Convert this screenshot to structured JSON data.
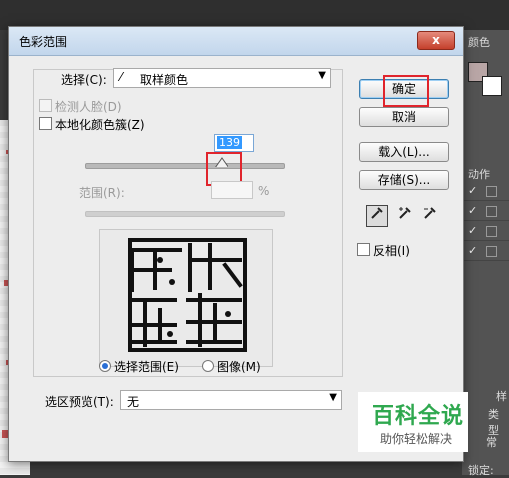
{
  "dialog": {
    "title": "色彩范围",
    "close_label": "x",
    "select_label": "选择(C):",
    "select_value": "取样颜色",
    "detect_faces_label": "检测人脸(D)",
    "localized_clusters_label": "本地化颜色簇(Z)",
    "fuzziness_value": "139",
    "range_label": "范围(R):",
    "range_unit": "%",
    "radio_selection_label": "选择范围(E)",
    "radio_image_label": "图像(M)",
    "preview_label": "选区预览(T):",
    "preview_value": "无",
    "ok_label": "确定",
    "cancel_label": "取消",
    "load_label": "载入(L)...",
    "save_label": "存储(S)...",
    "invert_label": "反相(I)",
    "fuzziness_slider_fraction": 0.69
  },
  "right_panel": {
    "color_tab": "颜色",
    "actions_tab": "动作",
    "type_label": "类型",
    "normal_label": "常",
    "lock_label": "锁定:",
    "ps_tab_text": "样"
  },
  "watermark": {
    "main": "百科全说",
    "sub": "助你轻松解决"
  },
  "colors": {
    "highlight_red": "#e0242c",
    "watermark_green": "#2fa84f"
  }
}
